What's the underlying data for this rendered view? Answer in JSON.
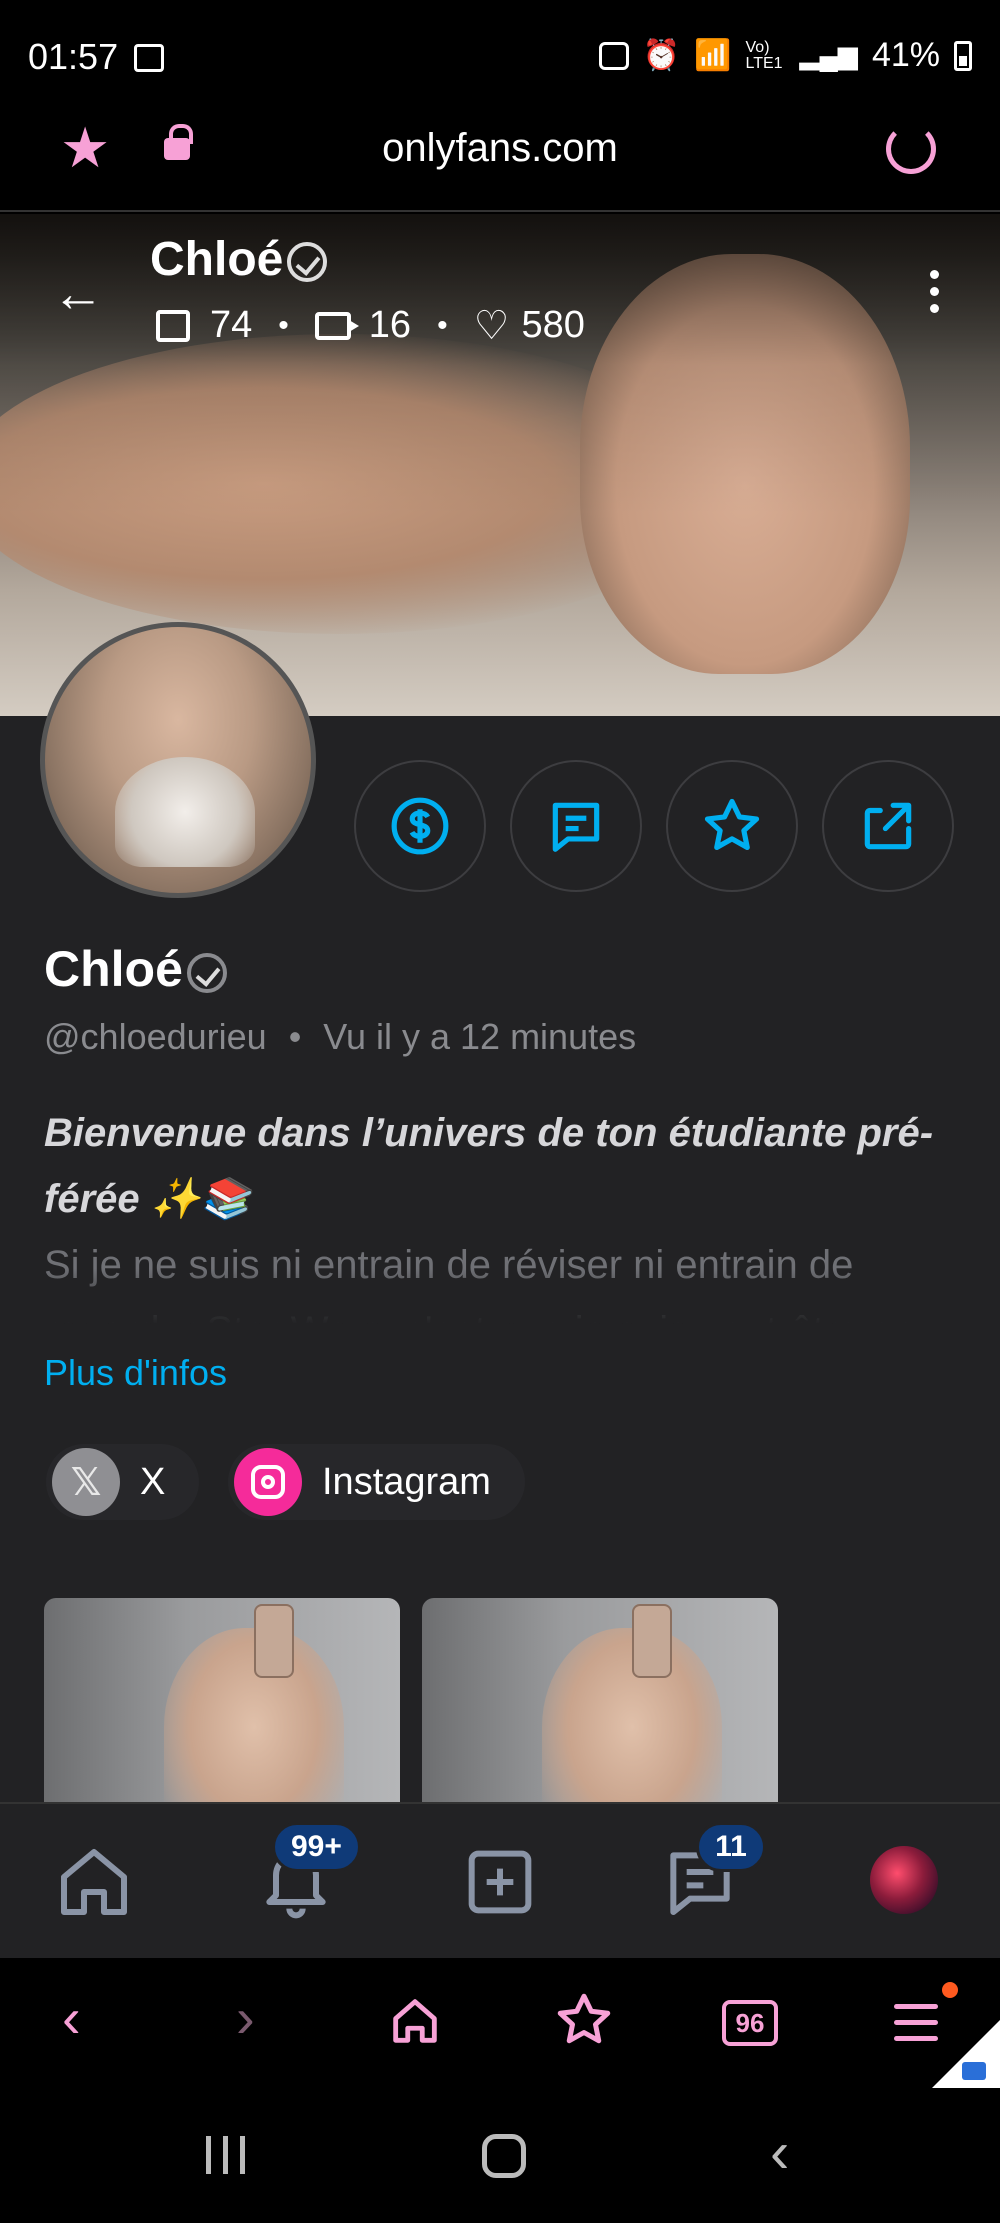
{
  "status_bar": {
    "time": "01:57",
    "network": "Vo) LTE1",
    "battery": "41%"
  },
  "browser": {
    "url": "onlyfans.com",
    "accent_color": "#f7a1d6",
    "tabs_count": "96"
  },
  "cover": {
    "name": "Chloé",
    "stats": {
      "photos": "74",
      "videos": "16",
      "likes": "580"
    }
  },
  "profile": {
    "name": "Chloé",
    "handle": "@chloedurieu",
    "separator": "•",
    "last_seen": "Vu  il y a 12 minutes",
    "bio_headline": "Bienvenue dans l’univers de ton étudiante pré-férée ✨📚",
    "bio_text": "Si je ne suis ni entrain de réviser ni entrain de regarder Star Wars, c'est que je suis peut-être en ligne",
    "more_info_label": "Plus d'infos",
    "accent_color": "#00aff0"
  },
  "actions": [
    {
      "name": "tip",
      "icon": "dollar-icon"
    },
    {
      "name": "message",
      "icon": "chat-icon"
    },
    {
      "name": "favorite",
      "icon": "star-icon"
    },
    {
      "name": "share",
      "icon": "share-icon"
    }
  ],
  "social_links": [
    {
      "label": "X",
      "icon": "x-logo-icon"
    },
    {
      "label": "Instagram",
      "icon": "instagram-icon"
    }
  ],
  "app_nav": {
    "notifications_badge": "99+",
    "messages_badge": "11"
  }
}
